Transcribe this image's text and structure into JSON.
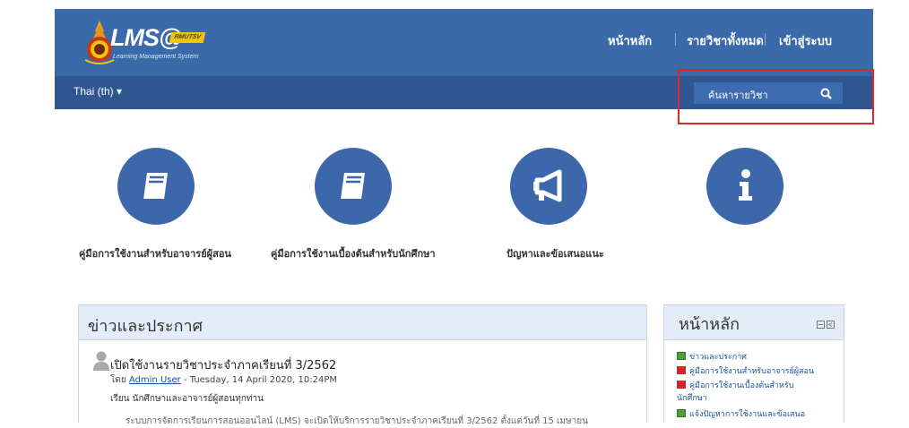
{
  "header": {
    "logo_text": "LMS@",
    "logo_badge": "RMUTSV",
    "logo_sub": "Learning Management System",
    "nav": [
      "หน้าหลัก",
      "รายวิชาทั้งหมด",
      "เข้าสู่ระบบ"
    ],
    "language": "Thai (th) ▾",
    "search_placeholder": "ค้นหารายวิชา"
  },
  "quicklinks": [
    {
      "label": "คู่มือการใช้งานสำหรับอาจารย์ผู้สอน",
      "icon": "book-icon"
    },
    {
      "label": "คู่มือการใช้งานเบื้องต้นสำหรับนักศึกษา",
      "icon": "book-icon"
    },
    {
      "label": "ปัญหาและข้อเสนอแนะ",
      "icon": "megaphone-icon"
    },
    {
      "label": "",
      "icon": "info-icon"
    }
  ],
  "news": {
    "title": "ข่าวและประกาศ",
    "post_title": "เปิดใช้งานรายวิชาประจำภาคเรียนที่ 3/2562",
    "post_by": "โดย",
    "post_author": "Admin User",
    "post_date": " - Tuesday, 14 April 2020, 10:24PM",
    "greeting": "เรียน นักศึกษาและอาจารย์ผู้สอนทุกท่าน",
    "body_cut": "ระบบการจัดการเรียนการสอนออนไลน์ (LMS) จะเปิดให้บริการรายวิชาประจำภาคเรียนที่ 3/2562 ตั้งแต่วันที่ 15 เมษายน"
  },
  "sidebar": {
    "title": "หน้าหลัก",
    "items": [
      {
        "label": "ข่าวและประกาศ",
        "icon": "forum-icon"
      },
      {
        "label": "คู่มือการใช้งานสำหรับอาจารย์ผู้สอน",
        "icon": "pdf-icon"
      },
      {
        "label": "คู่มือการใช้งานเบื้องต้นสำหรับ",
        "icon": "pdf-icon"
      },
      {
        "label": "นักศึกษา",
        "icon": ""
      },
      {
        "label": "แจ้งปัญหาการใช้งานและข้อเสนอ",
        "icon": "forum-icon"
      }
    ]
  },
  "colors": {
    "header": "#3b6aab",
    "subbar": "#2f568e",
    "circle": "#3d67ab",
    "highlight_box": "#e0252e"
  }
}
